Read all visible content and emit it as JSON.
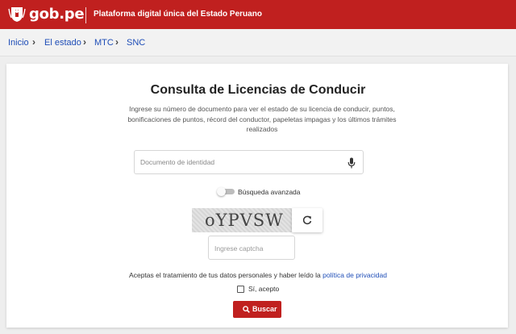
{
  "header": {
    "brand": "gob.pe",
    "platform": "Plataforma digital única del Estado Peruano",
    "logo_icon": "peru-shield-icon",
    "color": "#c0201f"
  },
  "breadcrumb": {
    "items": [
      "Inicio",
      "El estado",
      "MTC",
      "SNC"
    ]
  },
  "form": {
    "title": "Consulta de Licencias de Conducir",
    "description": "Ingrese su número de documento para ver el estado de su licencia de conducir, puntos, bonificaciones de puntos, récord del conductor, papeletas impagas y los últimos trámites realizados",
    "document_placeholder": "Documento de identidad",
    "advanced_search_label": "Búsqueda avanzada",
    "advanced_search_on": false,
    "captcha_text": "oYPVSW",
    "captcha_placeholder": "Ingrese captcha",
    "terms_text": "Aceptas el tratamiento de tus datos personales y haber leído la ",
    "terms_link": "política de privacidad",
    "accept_label": "Sí, acepto",
    "accept_checked": false,
    "submit_label": "Buscar"
  }
}
